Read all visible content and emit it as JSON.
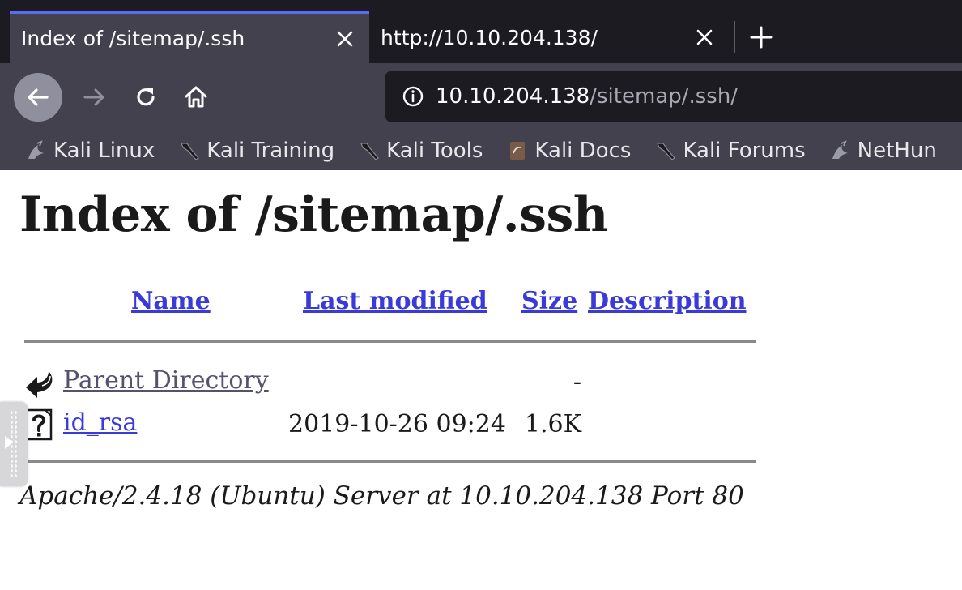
{
  "tabs": [
    {
      "title": "Index of /sitemap/.ssh",
      "active": true
    },
    {
      "title": "http://10.10.204.138/",
      "active": false
    }
  ],
  "toolbar": {
    "url_host": "10.10.204.138",
    "url_path": "/sitemap/.ssh/"
  },
  "bookmarks": [
    {
      "label": "Kali Linux",
      "icon": "kali-dragon-icon"
    },
    {
      "label": "Kali Training",
      "icon": "kali-tool-icon"
    },
    {
      "label": "Kali Tools",
      "icon": "kali-tool-icon"
    },
    {
      "label": "Kali Docs",
      "icon": "kali-docs-icon"
    },
    {
      "label": "Kali Forums",
      "icon": "kali-tool-icon"
    },
    {
      "label": "NetHun",
      "icon": "kali-dragon-icon"
    }
  ],
  "page": {
    "title": "Index of /sitemap/.ssh",
    "columns": {
      "name": "Name",
      "last_modified": "Last modified",
      "size": "Size",
      "description": "Description"
    },
    "rows": [
      {
        "name": "Parent Directory",
        "last_modified": "",
        "size": "-",
        "description": "",
        "icon": "back-arrow-icon"
      },
      {
        "name": "id_rsa",
        "last_modified": "2019-10-26 09:24",
        "size": "1.6K",
        "description": "",
        "icon": "unknown-file-icon"
      }
    ],
    "address": "Apache/2.4.18 (Ubuntu) Server at 10.10.204.138 Port 80"
  },
  "colors": {
    "link": "#3a3ad8",
    "visited_link": "#55526e",
    "tab_accent": "#5b6cf4",
    "chrome_dark": "#1c1b22",
    "chrome_mid": "#42414d"
  }
}
